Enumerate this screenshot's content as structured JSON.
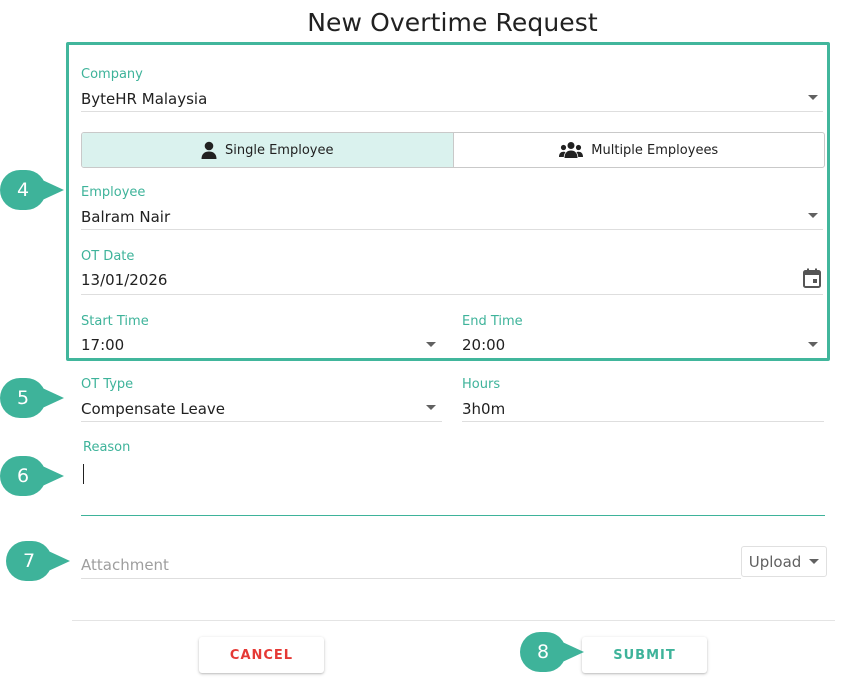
{
  "dialog": {
    "title": "New Overtime Request"
  },
  "company": {
    "label": "Company",
    "value": "ByteHR Malaysia"
  },
  "mode_toggle": {
    "single_label": "Single Employee",
    "multiple_label": "Multiple Employees",
    "selected": "single"
  },
  "employee": {
    "label": "Employee",
    "value": "Balram Nair"
  },
  "ot_date": {
    "label": "OT Date",
    "value": "13/01/2026"
  },
  "start_time": {
    "label": "Start Time",
    "value": "17:00"
  },
  "end_time": {
    "label": "End Time",
    "value": "20:00"
  },
  "ot_type": {
    "label": "OT Type",
    "value": "Compensate Leave"
  },
  "hours": {
    "label": "Hours",
    "value": "3h0m"
  },
  "reason": {
    "label": "Reason",
    "value": ""
  },
  "attachment": {
    "placeholder": "Attachment",
    "upload_label": "Upload"
  },
  "actions": {
    "cancel_label": "CANCEL",
    "submit_label": "SUBMIT"
  },
  "step_badges": [
    "4",
    "5",
    "6",
    "7",
    "8"
  ],
  "colors": {
    "accent": "#3eb39a",
    "danger": "#e53935",
    "selected_bg": "#daf2ee"
  },
  "icons": {
    "single": "person-icon",
    "multiple": "group-icon",
    "date": "calendar-icon",
    "dropdown": "caret-down-icon"
  }
}
